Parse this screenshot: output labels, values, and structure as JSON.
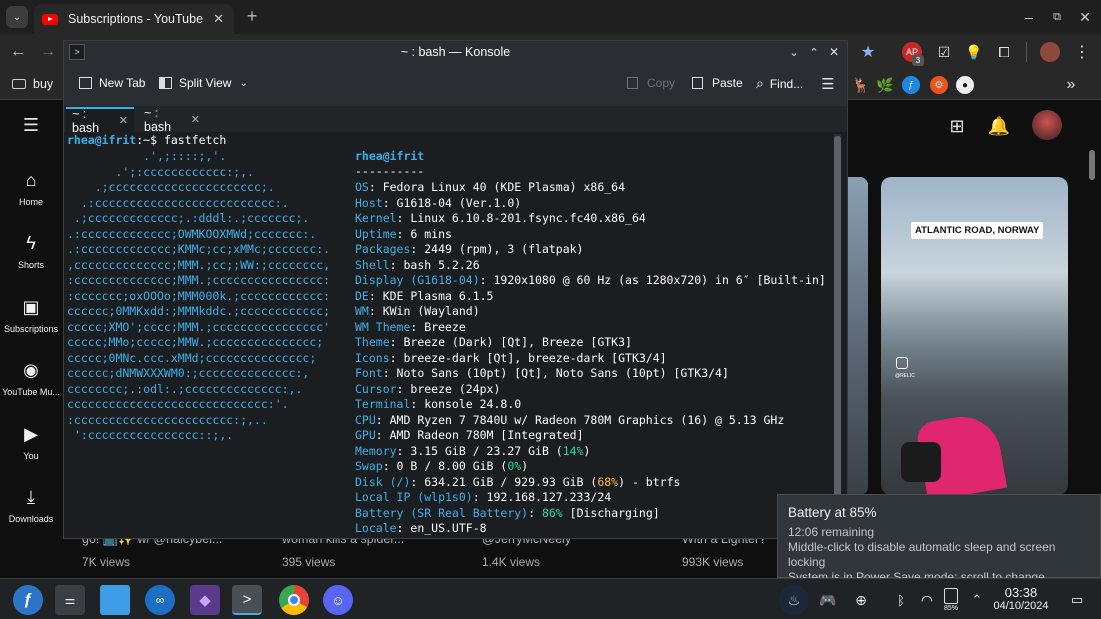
{
  "browser": {
    "tab_title": "Subscriptions - YouTube",
    "bookmark_label": "buy",
    "ext_badge": "3"
  },
  "youtube": {
    "nav": [
      {
        "label": "Home",
        "icon": "home-icon"
      },
      {
        "label": "Shorts",
        "icon": "shorts-icon"
      },
      {
        "label": "Subscriptions",
        "icon": "subscriptions-icon"
      },
      {
        "label": "YouTube Mu...",
        "icon": "youtube-music-icon"
      },
      {
        "label": "You",
        "icon": "you-icon"
      },
      {
        "label": "Downloads",
        "icon": "downloads-icon"
      }
    ],
    "shorts_overlay": "ATLANTIC ROAD, NORWAY",
    "shorts_watermark": "@RELIC",
    "shorts": [
      {
        "title": "go! 📺✨ w/ @halcybel...",
        "views": "7K views"
      },
      {
        "title": "woman kills a spider...",
        "views": "395 views"
      },
      {
        "title": "@JerryMcNeely",
        "views": "1.4K views"
      },
      {
        "title": "With a Lighter?",
        "views": "993K views"
      }
    ]
  },
  "konsole": {
    "title": "~ : bash — Konsole",
    "toolbar": {
      "new_tab": "New Tab",
      "split_view": "Split View",
      "copy": "Copy",
      "paste": "Paste",
      "find": "Find..."
    },
    "tabs": [
      "~ : bash",
      "~ : bash"
    ],
    "prompt_user": "rhea@ifrit",
    "prompt_path": ":~$ ",
    "command": "fastfetch",
    "header": "rhea@ifrit",
    "separator": "----------",
    "info": [
      {
        "key": "OS",
        "value": "Fedora Linux 40 (KDE Plasma) x86_64"
      },
      {
        "key": "Host",
        "value": "G1618-04 (Ver.1.0)"
      },
      {
        "key": "Kernel",
        "value": "Linux 6.10.8-201.fsync.fc40.x86_64"
      },
      {
        "key": "Uptime",
        "value": "6 mins"
      },
      {
        "key": "Packages",
        "value": "2449 (rpm), 3 (flatpak)"
      },
      {
        "key": "Shell",
        "value": "bash 5.2.26"
      },
      {
        "key": "Display (G1618-04)",
        "value": "1920x1080 @ 60 Hz (as 1280x720) in 6″ [Built-in]"
      },
      {
        "key": "DE",
        "value": "KDE Plasma 6.1.5"
      },
      {
        "key": "WM",
        "value": "KWin (Wayland)"
      },
      {
        "key": "WM Theme",
        "value": "Breeze"
      },
      {
        "key": "Theme",
        "value": "Breeze (Dark) [Qt], Breeze [GTK3]"
      },
      {
        "key": "Icons",
        "value": "breeze-dark [Qt], breeze-dark [GTK3/4]"
      },
      {
        "key": "Font",
        "value": "Noto Sans (10pt) [Qt], Noto Sans (10pt) [GTK3/4]"
      },
      {
        "key": "Cursor",
        "value": "breeze (24px)"
      },
      {
        "key": "Terminal",
        "value": "konsole 24.8.0"
      },
      {
        "key": "CPU",
        "value": "AMD Ryzen 7 7840U w/ Radeon 780M Graphics (16) @ 5.13 GHz"
      },
      {
        "key": "GPU",
        "value": "AMD Radeon 780M [Integrated]"
      },
      {
        "key": "Memory",
        "value": "3.15 GiB / 23.27 GiB (",
        "pct": "14%",
        "pct_color": "green",
        "tail": ")"
      },
      {
        "key": "Swap",
        "value": "0 B / 8.00 GiB (",
        "pct": "0%",
        "pct_color": "green",
        "tail": ")"
      },
      {
        "key": "Disk (/)",
        "value": "634.21 GiB / 929.93 GiB (",
        "pct": "68%",
        "pct_color": "yellow",
        "tail": ") - btrfs"
      },
      {
        "key": "Local IP (wlp1s0)",
        "value": "192.168.127.233/24"
      },
      {
        "key": "Battery (SR Real Battery)",
        "value": "",
        "pct": "86%",
        "pct_color": "green",
        "tail": " [Discharging]"
      },
      {
        "key": "Locale",
        "value": "en_US.UTF-8"
      }
    ],
    "logo": [
      "           .',;::::;,'.",
      "       .';:cccccccccccc:;,.",
      "    .;cccccccccccccccccccccc;.",
      "  .:cccccccccccccccccccccccccc:.",
      " .;ccccccccccccc;.:dddl:.;ccccccc;.",
      ".:ccccccccccccc;OWMKOOXMWd;ccccccc:.",
      ".:ccccccccccccc;KMMc;cc;xMMc;ccccccc:.",
      ",cccccccccccccc;MMM.;cc;;WW:;cccccccc,",
      ":cccccccccccccc;MMM.;cccccccccccccccc:",
      ":ccccccc;oxOOOo;MMM000k.;cccccccccccc:",
      "cccccc;0MMKxdd:;MMMkddc.;cccccccccccc;",
      "ccccc;XMO';cccc;MMM.;cccccccccccccccc'",
      "ccccc;MMo;ccccc;MMW.;ccccccccccccccc;",
      "ccccc;0MNc.ccc.xMMd;ccccccccccccccc;",
      "cccccc;dNMWXXXWM0:;cccccccccccccc:,",
      "cccccccc;.:odl:.;cccccccccccccc:,.",
      "ccccccccccccccccccccccccccccc:'.",
      ":ccccccccccccccccccccccc:;,..",
      " ':cccccccccccccccc::;,."
    ]
  },
  "battery_popup": {
    "title": "Battery at 85%",
    "remaining": "12:06 remaining",
    "hint": "Middle-click to disable automatic sleep and screen locking",
    "mode": "System is in Power Save mode; scroll to change"
  },
  "taskbar": {
    "battery_label": "85%",
    "time": "03:38",
    "date": "04/10/2024"
  }
}
